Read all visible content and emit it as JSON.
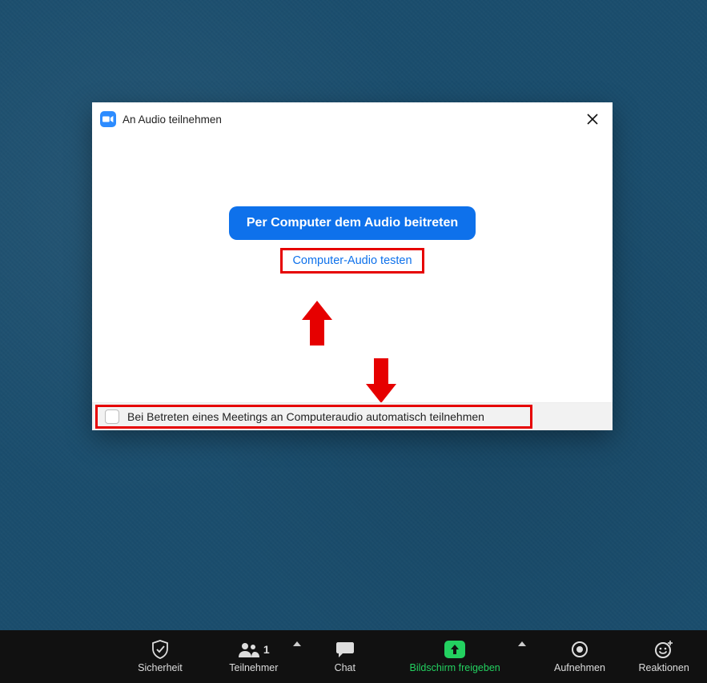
{
  "dialog": {
    "title": "An Audio teilnehmen",
    "primary_button": "Per Computer dem Audio beitreten",
    "test_link": "Computer-Audio testen",
    "auto_join_label": "Bei Betreten eines Meetings an Computeraudio automatisch teilnehmen"
  },
  "toolbar": {
    "security": "Sicherheit",
    "participants": "Teilnehmer",
    "participants_count": "1",
    "chat": "Chat",
    "share": "Bildschirm freigeben",
    "record": "Aufnehmen",
    "reactions": "Reaktionen"
  },
  "colors": {
    "accent": "#0E71EB",
    "highlight": "#E60000",
    "share_green": "#23D160"
  }
}
